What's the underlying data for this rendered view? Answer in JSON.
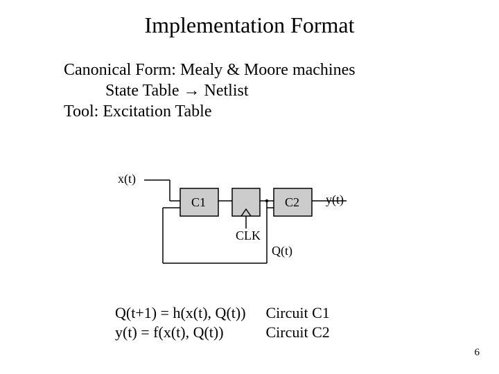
{
  "title": "Implementation Format",
  "body": {
    "line1": "Canonical Form: Mealy & Moore machines",
    "line2": "State Table → Netlist",
    "line3": "Tool: Excitation Table"
  },
  "diagram": {
    "x_label": "x(t)",
    "c1_label": "C1",
    "c2_label": "C2",
    "y_label": "y(t)",
    "clk_label": "CLK",
    "q_label": "Q(t)"
  },
  "equations": {
    "row1_lhs": "Q(t+1) = h(x(t), Q(t))",
    "row1_tag": "Circuit C1",
    "row2_lhs": "y(t) = f(x(t), Q(t))",
    "row2_tag": "Circuit C2"
  },
  "page_number": "6",
  "colors": {
    "box_fill": "#cccccc",
    "box_stroke": "#000000",
    "wire": "#000000"
  }
}
